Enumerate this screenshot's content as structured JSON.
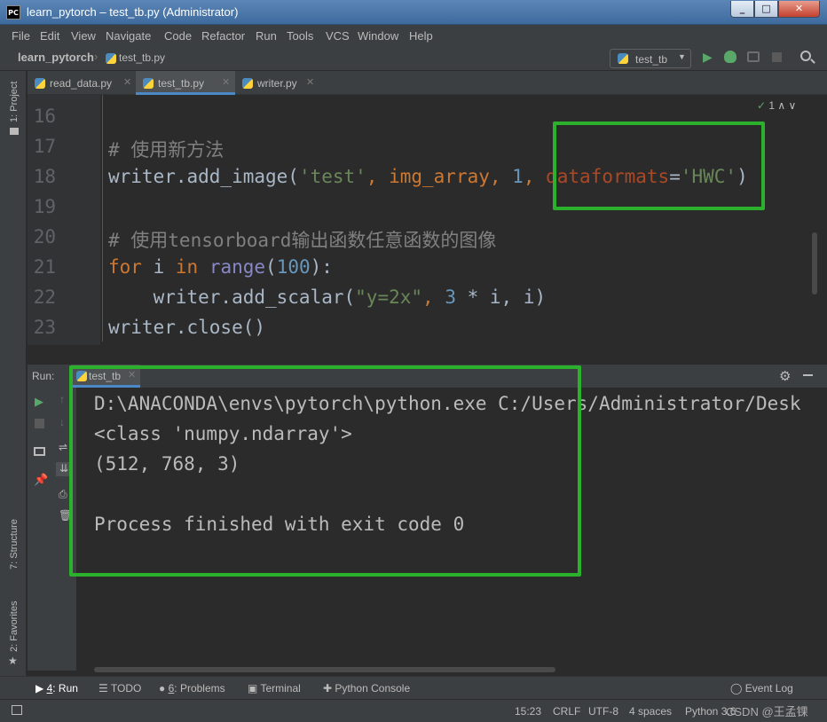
{
  "window": {
    "app_icon": "PC",
    "title": "learn_pytorch – test_tb.py (Administrator)"
  },
  "menu": [
    "File",
    "Edit",
    "View",
    "Navigate",
    "Code",
    "Refactor",
    "Run",
    "Tools",
    "VCS",
    "Window",
    "Help"
  ],
  "breadcrumb": {
    "project": "learn_pytorch",
    "file": "test_tb.py"
  },
  "run_config": {
    "label": "test_tb"
  },
  "tabs": [
    {
      "label": "read_data.py",
      "active": false
    },
    {
      "label": "test_tb.py",
      "active": true
    },
    {
      "label": "writer.py",
      "active": false
    }
  ],
  "inspection": {
    "count": "1"
  },
  "editor": {
    "line_numbers": [
      "16",
      "17",
      "18",
      "19",
      "20",
      "21",
      "22",
      "23"
    ],
    "l17_comment": "# 使用新方法",
    "l18": {
      "obj": "writer.add_image(",
      "s1": "'test'",
      "c1": ", img_array, ",
      "n1": "1",
      "c2": ", ",
      "param": "dataformats",
      "eq": "=",
      "s2": "'HWC'",
      "close": ")"
    },
    "l20_comment": "# 使用tensorboard输出函数任意函数的图像",
    "l21": {
      "kw1": "for",
      "var": " i ",
      "kw2": "in",
      "sp": " ",
      "builtin": "range",
      "open": "(",
      "num": "100",
      "close": "):"
    },
    "l22": {
      "a": "    writer.add_scalar(",
      "s": "\"y=2x\"",
      "b": ", ",
      "n": "3",
      "c": " * i, i)"
    },
    "l23": "writer.close()"
  },
  "run_panel": {
    "label": "Run:",
    "tab": "test_tb",
    "output": [
      "D:\\ANACONDA\\envs\\pytorch\\python.exe C:/Users/Administrator/Desk",
      "<class 'numpy.ndarray'>",
      "(512, 768, 3)",
      "",
      "Process finished with exit code 0"
    ]
  },
  "left_strip": {
    "project": "1: Project",
    "structure": "7: Structure",
    "favorites": "2: Favorites"
  },
  "bottom_tabs": [
    {
      "num": "4",
      "label": ": Run"
    },
    {
      "label": "TODO"
    },
    {
      "num": "6",
      "label": ": Problems"
    },
    {
      "label": "Terminal"
    },
    {
      "label": "Python Console"
    }
  ],
  "event_log": "Event Log",
  "status": {
    "position": "15:23",
    "line_sep": "CRLF",
    "encoding": "UTF-8",
    "indent": "4 spaces",
    "interpreter": "Python 3.6",
    "watermark": "CSDN @王孟锞"
  },
  "colors": {
    "highlight_box": "#2bb12b",
    "accent": "#4a88c7"
  }
}
